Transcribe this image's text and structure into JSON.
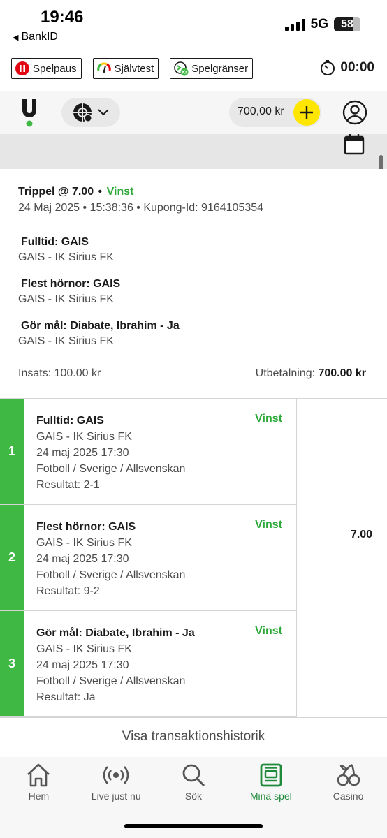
{
  "status_bar": {
    "time": "19:46",
    "network": "5G",
    "battery": "58",
    "back_app": "BankID"
  },
  "rg_bar": {
    "pause_label": "Spelpaus",
    "selftest_label": "Självtest",
    "limits_label": "Spelgränser",
    "timer": "00:00"
  },
  "header": {
    "balance": "700,00 kr"
  },
  "bet": {
    "type": "Trippel @ 7.00",
    "status": "Vinst",
    "meta": "24 Maj 2025 • 15:38:36 • Kupong-Id: 9164105354",
    "selections": [
      {
        "title": "Fulltid: GAIS",
        "match": "GAIS - IK Sirius FK"
      },
      {
        "title": "Flest hörnor: GAIS",
        "match": "GAIS - IK Sirius FK"
      },
      {
        "title": "Gör mål: Diabate, Ibrahim - Ja",
        "match": "GAIS - IK Sirius FK"
      }
    ],
    "stake": "Insats: 100.00 kr",
    "payout_label": "Utbetalning:",
    "payout_value": "700.00 kr"
  },
  "legs": [
    {
      "num": "1",
      "title": "Fulltid: GAIS",
      "status": "Vinst",
      "match": "GAIS - IK Sirius FK",
      "date": "24 maj 2025 17:30",
      "league": "Fotboll / Sverige / Allsvenskan",
      "result": "Resultat: 2-1"
    },
    {
      "num": "2",
      "title": "Flest hörnor: GAIS",
      "status": "Vinst",
      "match": "GAIS - IK Sirius FK",
      "date": "24 maj 2025 17:30",
      "league": "Fotboll / Sverige / Allsvenskan",
      "result": "Resultat: 9-2"
    },
    {
      "num": "3",
      "title": "Gör mål: Diabate, Ibrahim - Ja",
      "status": "Vinst",
      "match": "GAIS - IK Sirius FK",
      "date": "24 maj 2025 17:30",
      "league": "Fotboll / Sverige / Allsvenskan",
      "result": "Resultat: Ja"
    }
  ],
  "total_odds": "7.00",
  "history_link": "Visa transaktionshistorik",
  "nav": [
    {
      "label": "Hem",
      "icon": "home-icon"
    },
    {
      "label": "Live just nu",
      "icon": "live-icon"
    },
    {
      "label": "Sök",
      "icon": "search-icon"
    },
    {
      "label": "Mina spel",
      "icon": "my-bets-icon",
      "active": true
    },
    {
      "label": "Casino",
      "icon": "cherries-icon"
    }
  ],
  "colors": {
    "accent_green": "#3fb944",
    "win_text": "#2eaa3b",
    "nav_active": "#1f8a3b",
    "deposit_yellow": "#ffe600"
  }
}
